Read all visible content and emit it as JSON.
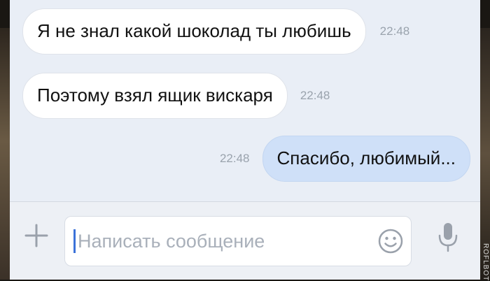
{
  "messages": [
    {
      "text": "Я не знал какой шоколад ты любишь",
      "time": "22:48",
      "direction": "incoming"
    },
    {
      "text": "Поэтому взял ящик вискаря",
      "time": "22:48",
      "direction": "incoming"
    },
    {
      "text": "Спасибо, любимый...",
      "time": "22:48",
      "direction": "outgoing"
    }
  ],
  "composer": {
    "placeholder": "Написать сообщение",
    "icons": {
      "attach": "plus-icon",
      "emoji": "smile-icon",
      "voice": "microphone-icon"
    }
  },
  "watermark": "ROFLBOT",
  "colors": {
    "chat_background": "#e9eef6",
    "incoming_bubble": "#ffffff",
    "outgoing_bubble": "#cfe0f8",
    "time_text": "#9aa3ad",
    "icon_gray": "#9aa1ab",
    "caret": "#3b72d9"
  }
}
